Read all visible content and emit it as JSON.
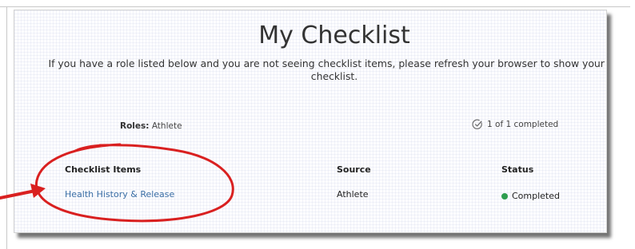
{
  "page": {
    "title": "My Checklist",
    "notice_line1": "If you have a role listed below and you are not seeing checklist items, please refresh your browser to show your up",
    "notice_line2": "checklist."
  },
  "summary": {
    "roles_label": "Roles:",
    "roles_value": "Athlete",
    "completed_text": "1 of 1 completed"
  },
  "table": {
    "headers": {
      "item": "Checklist Items",
      "source": "Source",
      "status": "Status"
    },
    "rows": [
      {
        "item": "Health History & Release",
        "source": "Athlete",
        "status": "Completed"
      }
    ]
  },
  "colors": {
    "link": "#3a6ea5",
    "status_completed": "#2f9e4f",
    "annotation": "#d92020"
  },
  "icons": {
    "progress": "circle-check-icon",
    "status": "status-dot-icon"
  }
}
